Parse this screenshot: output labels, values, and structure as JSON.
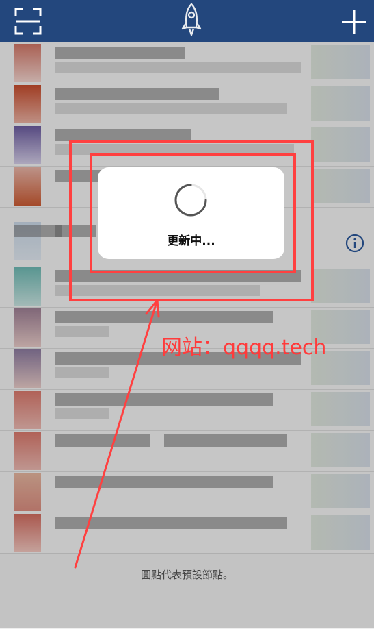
{
  "topbar": {
    "left_icon": "scan-icon",
    "center_icon": "rocket-icon",
    "right_icon": "plus-icon"
  },
  "dialog": {
    "text": "更新中..."
  },
  "watermark": {
    "text": "网站：qqqq.tech"
  },
  "footer": {
    "text": "圓點代表預設節點。"
  },
  "colors": {
    "topbar": "#23477d",
    "frame": "#ff4040",
    "watermark": "#ff3b3b",
    "info_icon": "#23477d"
  }
}
